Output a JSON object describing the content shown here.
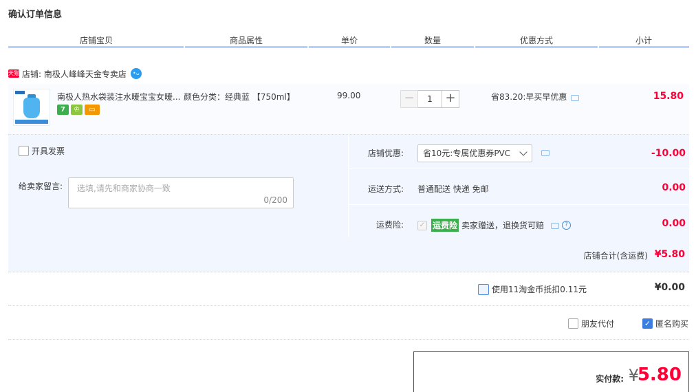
{
  "page_title": "确认订单信息",
  "columns": [
    "店铺宝贝",
    "商品属性",
    "单价",
    "数量",
    "优惠方式",
    "小计"
  ],
  "shop": {
    "badge": "天猫",
    "label": "店铺: 南极人峰峰天金专卖店"
  },
  "item": {
    "name": "南极人热水袋装注水暖宝宝女暖...",
    "sku": "颜色分类：经典蓝 【750ml】",
    "price": "99.00",
    "quantity": "1",
    "minus": "−",
    "plus": "+",
    "promo": "省83.20:早买早优惠",
    "subtotal": "15.80",
    "service_icons": [
      {
        "name": "7-day-return-icon",
        "glyph": "7",
        "color": "#3cae4d"
      },
      {
        "name": "guarantee-icon",
        "glyph": "♔",
        "color": "#8cc63f"
      },
      {
        "name": "credit-card-icon",
        "glyph": "▭",
        "color": "#f39800"
      }
    ]
  },
  "invoice": {
    "label": "开具发票"
  },
  "message": {
    "label": "给卖家留言:",
    "placeholder": "选填,请先和商家协商一致",
    "counter": "0/200"
  },
  "shop_discount": {
    "label": "店铺优惠:",
    "selected": "省10元:专属优惠券PVC",
    "value": "-10.00"
  },
  "shipping": {
    "label": "运送方式:",
    "method": "普通配送 快递 免邮",
    "value": "0.00"
  },
  "insurance": {
    "label": "运费险:",
    "tag": "运费险",
    "text": "卖家赠送，退换货可赔",
    "help": "?",
    "value": "0.00"
  },
  "shop_total": {
    "label": "店铺合计(含运费)",
    "value": "¥5.80"
  },
  "coins": {
    "label": "使用11淘金币抵扣0.11元",
    "value": "¥0.00"
  },
  "options": {
    "friend_pay": "朋友代付",
    "anonymous": "匿名购买",
    "anonymous_checked": true
  },
  "payment": {
    "label": "实付款:",
    "currency": "¥",
    "amount": "5.80"
  }
}
